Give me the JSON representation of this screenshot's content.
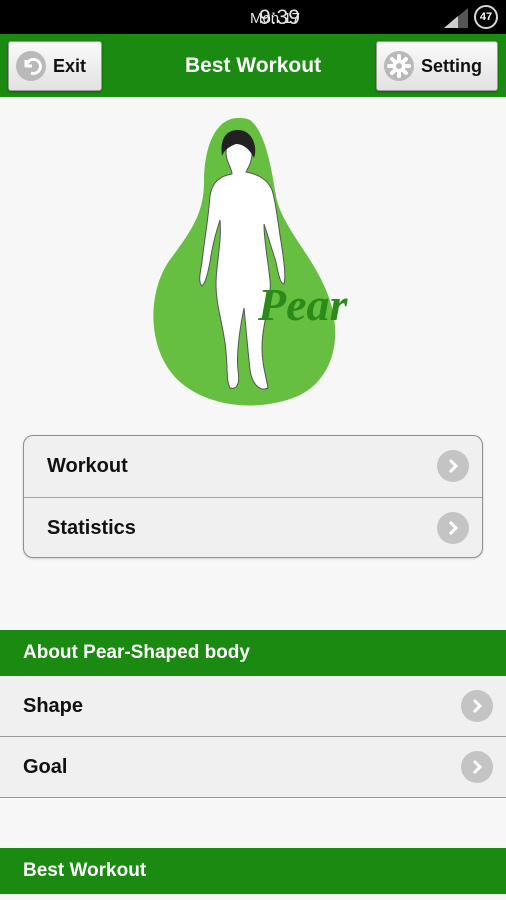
{
  "status_bar": {
    "date": "Mon 17",
    "time": "9:39",
    "battery": "47"
  },
  "action_bar": {
    "exit_label": "Exit",
    "title": "Best Workout",
    "setting_label": "Setting"
  },
  "logo": {
    "text": "Pear"
  },
  "main_menu": [
    {
      "label": "Workout"
    },
    {
      "label": "Statistics"
    }
  ],
  "about_section": {
    "header": "About Pear-Shaped body",
    "items": [
      {
        "label": "Shape"
      },
      {
        "label": "Goal"
      }
    ]
  },
  "best_section": {
    "header": "Best Workout"
  },
  "colors": {
    "brand_green": "#1a8a10",
    "logo_green": "#66bf40",
    "chevron_gray": "#c4c4c4"
  }
}
